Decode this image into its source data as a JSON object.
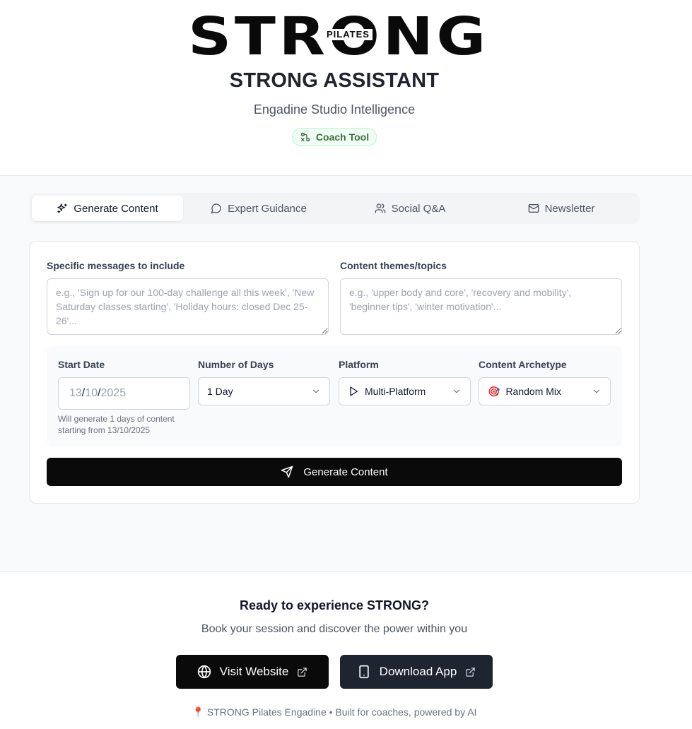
{
  "header": {
    "logo_word": "STRONG",
    "logo_sub": "PILATES",
    "title": "STRONG ASSISTANT",
    "subtitle": "Engadine Studio Intelligence",
    "badge": "Coach Tool"
  },
  "tabs": [
    {
      "label": "Generate Content",
      "icon": "sparkles-icon",
      "active": true
    },
    {
      "label": "Expert Guidance",
      "icon": "message-circle-icon",
      "active": false
    },
    {
      "label": "Social Q&A",
      "icon": "users-icon",
      "active": false
    },
    {
      "label": "Newsletter",
      "icon": "mail-icon",
      "active": false
    }
  ],
  "form": {
    "messages_label": "Specific messages to include",
    "messages_placeholder": "e.g., 'Sign up for our 100-day challenge all this week', 'New Saturday classes starting', 'Holiday hours: closed Dec 25-26'...",
    "themes_label": "Content themes/topics",
    "themes_placeholder": "e.g., 'upper body and core', 'recovery and mobility', 'beginner tips', 'winter motivation'...",
    "start_date_label": "Start Date",
    "start_date": {
      "day": "13",
      "month": "10",
      "year": "2025",
      "sep": "/"
    },
    "start_date_hint": "Will generate 1 days of content starting from 13/10/2025",
    "days_label": "Number of Days",
    "days_value": "1 Day",
    "platform_label": "Platform",
    "platform_value": "Multi-Platform",
    "archetype_label": "Content Archetype",
    "archetype_value": "Random Mix",
    "archetype_emoji": "🎯",
    "submit_label": "Generate Content"
  },
  "footer": {
    "cta_title": "Ready to experience STRONG?",
    "cta_subtitle": "Book your session and discover the power within you",
    "visit_label": "Visit Website",
    "download_label": "Download App",
    "note": "STRONG Pilates Engadine • Built for coaches, powered by AI",
    "note_emoji": "📍"
  },
  "colors": {
    "primary": "#0a0a0a",
    "badge_bg": "#f0fdf4",
    "badge_text": "#3f6d3f",
    "app_button": "#1f2431"
  }
}
